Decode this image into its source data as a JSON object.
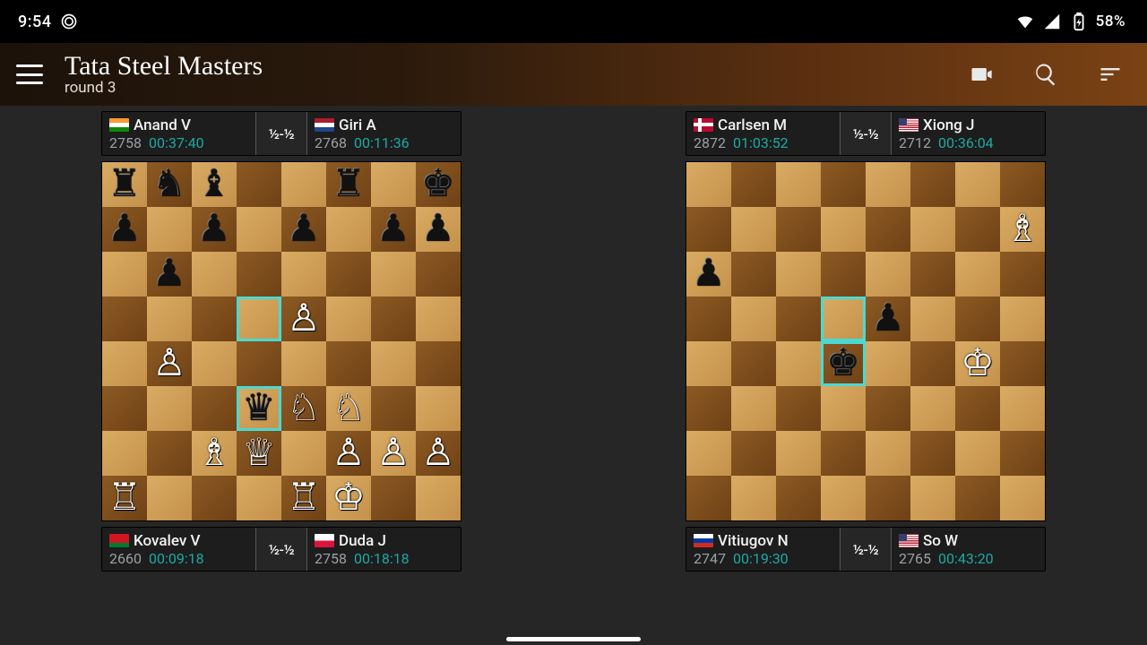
{
  "status": {
    "time": "9:54",
    "battery": "58%"
  },
  "app": {
    "title": "Tata Steel Masters",
    "subtitle": "round 3"
  },
  "flags": {
    "IN": "flag-in",
    "NL": "flag-nl",
    "NO": "flag-no",
    "US": "flag-us",
    "BY": "flag-by",
    "PL": "flag-pl",
    "RU": "flag-ru"
  },
  "games": [
    {
      "left": {
        "flag": "IN",
        "name": "Anand V",
        "rating": "2758",
        "time": "00:37:40"
      },
      "right": {
        "flag": "NL",
        "name": "Giri A",
        "rating": "2768",
        "time": "00:11:36"
      },
      "result": "½-½",
      "highlights": [
        "d5",
        "d3"
      ],
      "position_rows": [
        "rnb..r.k",
        "p.p.p.pp",
        ".p......",
        "....P...",
        ".P......",
        "...qNN..",
        "..BQ.PPP",
        "R...RK.."
      ]
    },
    {
      "left": {
        "flag": "NO",
        "name": "Carlsen M",
        "rating": "2872",
        "time": "01:03:52"
      },
      "right": {
        "flag": "US",
        "name": "Xiong J",
        "rating": "2712",
        "time": "00:36:04"
      },
      "result": "½-½",
      "highlights": [
        "d5",
        "d4"
      ],
      "position_rows": [
        "........",
        ".......B",
        "p.......",
        "....p...",
        "...k..K.",
        "........",
        "........",
        "........"
      ]
    }
  ],
  "below": [
    {
      "left": {
        "flag": "BY",
        "name": "Kovalev V",
        "rating": "2660",
        "time": "00:09:18"
      },
      "right": {
        "flag": "PL",
        "name": "Duda J",
        "rating": "2758",
        "time": "00:18:18"
      },
      "result": "½-½"
    },
    {
      "left": {
        "flag": "RU",
        "name": "Vitiugov N",
        "rating": "2747",
        "time": "00:19:30"
      },
      "right": {
        "flag": "US",
        "name": "So W",
        "rating": "2765",
        "time": "00:43:20"
      },
      "result": "½-½"
    }
  ],
  "pieces": {
    "K": "♔",
    "Q": "♕",
    "R": "♖",
    "B": "♗",
    "N": "♘",
    "P": "♙",
    "k": "♚",
    "q": "♛",
    "r": "♜",
    "b": "♝",
    "n": "♞",
    "p": "♟"
  }
}
